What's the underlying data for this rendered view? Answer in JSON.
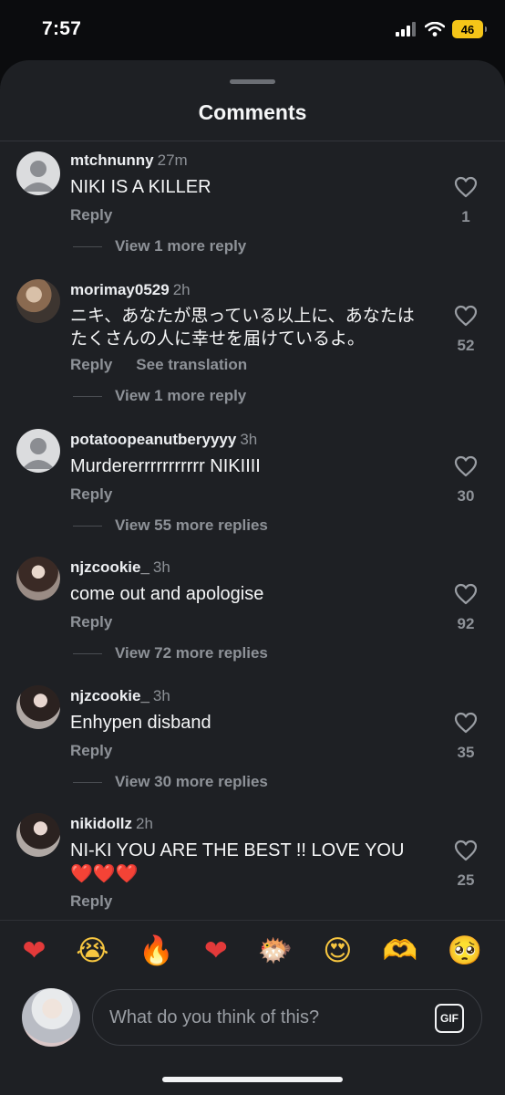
{
  "status": {
    "time": "7:57",
    "battery": "46"
  },
  "sheet": {
    "title": "Comments"
  },
  "comments": [
    {
      "user": "mtchnunny",
      "ago": "27m",
      "text": "NIKI IS A KILLER",
      "reply": "Reply",
      "likes": "1",
      "view_replies": "View 1 more reply"
    },
    {
      "user": "morimay0529",
      "ago": "2h",
      "text": "ニキ、あなたが思っている以上に、あなたはたくさんの人に幸せを届けているよ。",
      "reply": "Reply",
      "translate": "See translation",
      "likes": "52",
      "view_replies": "View 1 more reply"
    },
    {
      "user": "potatoopeanutberyyyy",
      "ago": "3h",
      "text": "Murdererrrrrrrrrrr NIKIIII",
      "reply": "Reply",
      "likes": "30",
      "view_replies": "View 55 more replies"
    },
    {
      "user": "njzcookie_",
      "ago": "3h",
      "text": "come out and apologise",
      "reply": "Reply",
      "likes": "92",
      "view_replies": "View 72 more replies"
    },
    {
      "user": "njzcookie_",
      "ago": "3h",
      "text": "Enhypen disband",
      "reply": "Reply",
      "likes": "35",
      "view_replies": "View 30 more replies"
    },
    {
      "user": "nikidollz",
      "ago": "2h",
      "text": "NI-KI YOU ARE THE BEST !! LOVE YOU",
      "text2": "❤️❤️❤️",
      "reply": "Reply",
      "likes": "25"
    }
  ],
  "reactions": [
    "❤",
    "😭",
    "🔥",
    "❤",
    "🐡",
    "😍",
    "🫶",
    "🥺"
  ],
  "composer": {
    "placeholder": "What do you think of this?",
    "gif_label": "GIF"
  }
}
